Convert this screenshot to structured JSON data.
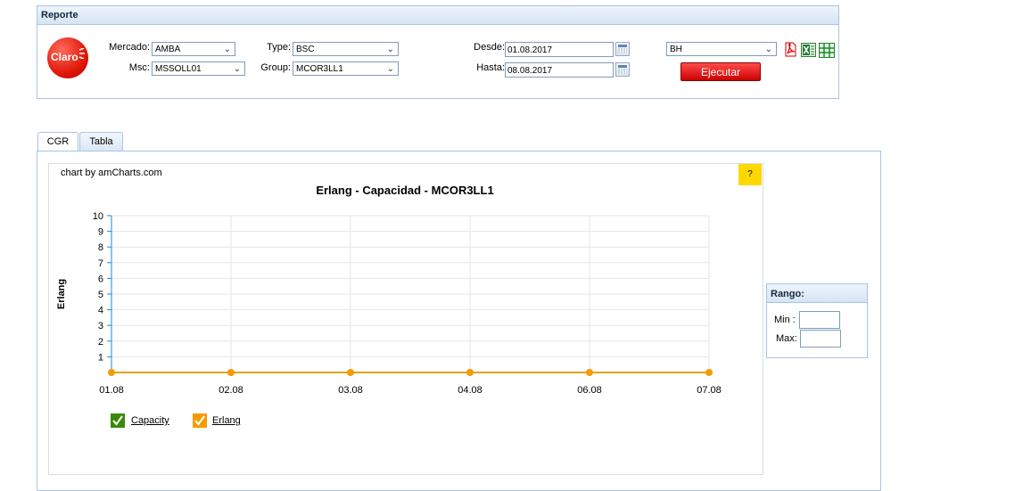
{
  "report": {
    "title": "Reporte",
    "logo_text": "Claro",
    "mercado_label": "Mercado:",
    "mercado_value": "AMBA",
    "msc_label": "Msc:",
    "msc_value": "MSSOLL01",
    "type_label": "Type:",
    "type_value": "BSC",
    "group_label": "Group:",
    "group_value": "MCOR3LL1",
    "desde_label": "Desde:",
    "desde_value": "01.08.2017",
    "hasta_label": "Hasta:",
    "hasta_value": "08.08.2017",
    "period_value": "BH",
    "run_label": "Ejecutar",
    "icons": [
      "pdf-export-icon",
      "excel-export-icon",
      "grid-export-icon",
      "calendar-icon"
    ]
  },
  "tabs": [
    {
      "label": "CGR",
      "active": true
    },
    {
      "label": "Tabla",
      "active": false
    }
  ],
  "chart_panel": {
    "credit": "chart by amCharts.com",
    "help_label": "?"
  },
  "chart_data": {
    "type": "line",
    "title": "Erlang - Capacidad - MCOR3LL1",
    "xlabel": "",
    "ylabel": "Erlang",
    "categories": [
      "01.08",
      "02.08",
      "03.08",
      "04.08",
      "06.08",
      "07.08"
    ],
    "ylim": [
      0,
      10
    ],
    "yticks": [
      1,
      2,
      3,
      4,
      5,
      6,
      7,
      8,
      9,
      10
    ],
    "grid": true,
    "legend_position": "bottom-left",
    "series": [
      {
        "name": "Capacity",
        "values": [
          0,
          0,
          0,
          0,
          0,
          0
        ],
        "color": "#3a8a0a"
      },
      {
        "name": "Erlang",
        "values": [
          0,
          0,
          0,
          0,
          0,
          0
        ],
        "color": "#f59a00"
      }
    ]
  },
  "range": {
    "title": "Rango:",
    "min_label": "Min :",
    "min_value": "",
    "max_label": "Max:",
    "max_value": ""
  },
  "colors": {
    "accent_blue": "#a9c4e2",
    "run_red": "#cc0000",
    "help_yellow": "#ffd800",
    "capacity_green": "#3a8a0a",
    "erlang_orange": "#f59a00"
  }
}
